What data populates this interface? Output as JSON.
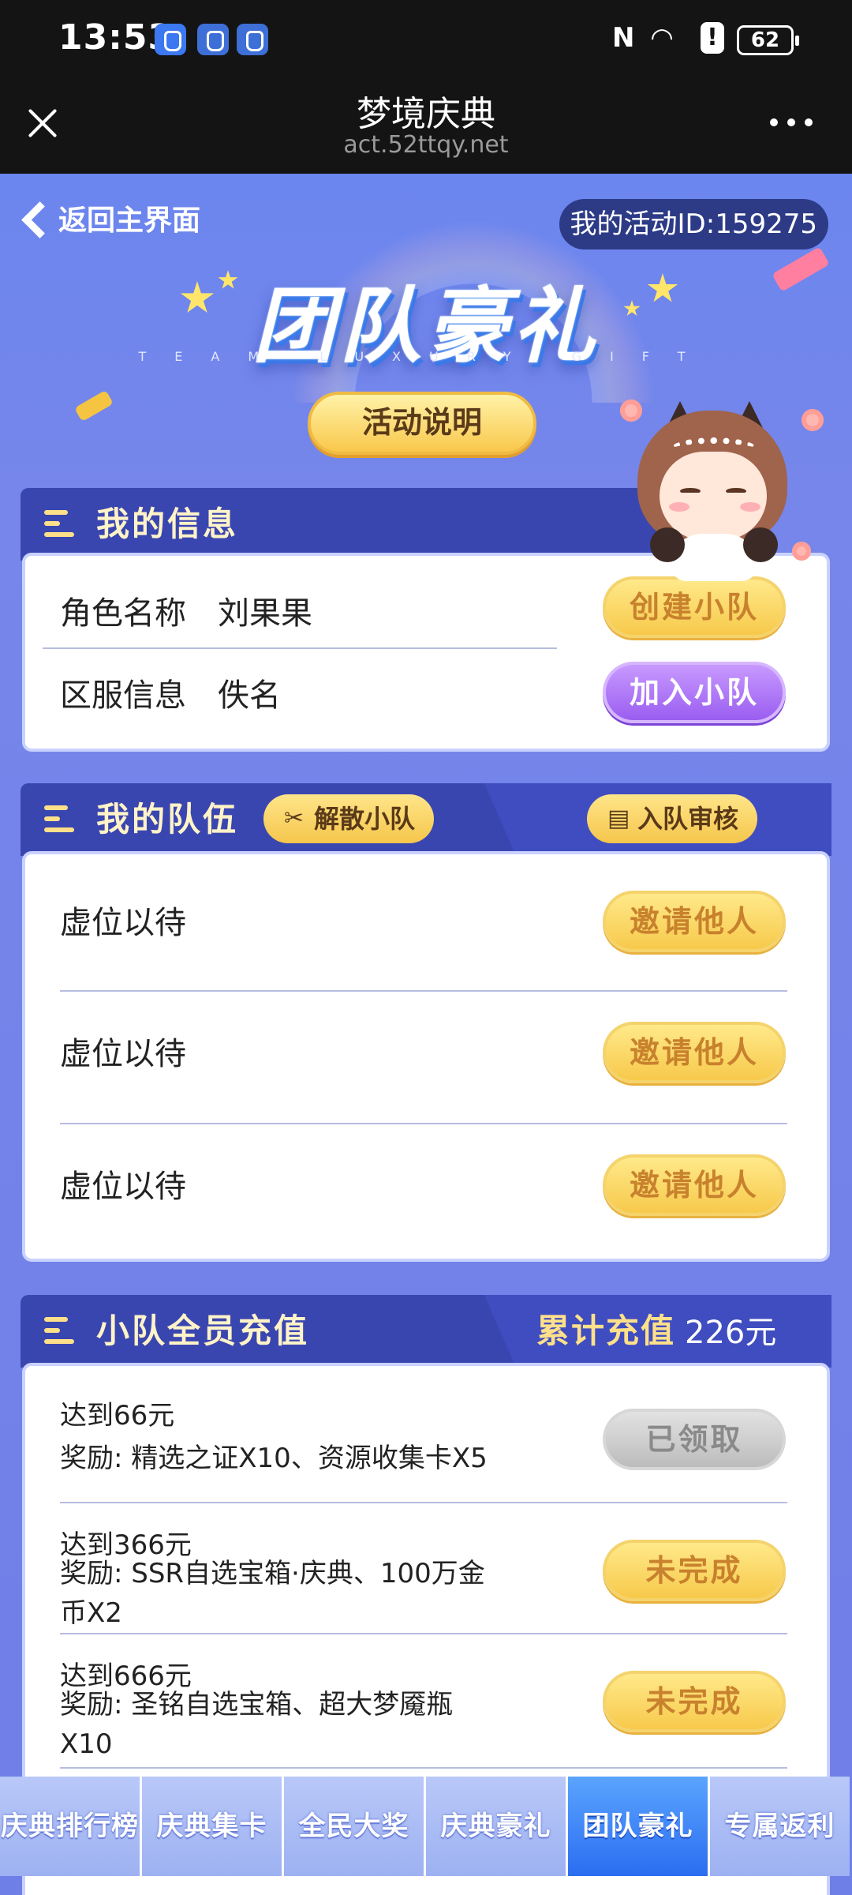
{
  "status_bar": {
    "time": "13:53",
    "battery": "62",
    "icons": [
      "shield-app-icon",
      "app-icon",
      "app-icon",
      "nfc-icon",
      "wifi-icon",
      "alert-icon",
      "battery-icon"
    ]
  },
  "browser": {
    "title": "梦境庆典",
    "url": "act.52ttqy.net"
  },
  "top": {
    "back_label": "返回主界面",
    "activity_id": "我的活动ID:159275",
    "hero_title": "团队豪礼",
    "hero_subtitle": "TEAM LUXURY GIFT",
    "info_button": "活动说明"
  },
  "my_info": {
    "title": "我的信息",
    "role_label": "角色名称",
    "role_value": "刘果果",
    "server_label": "区服信息",
    "server_value": "佚名",
    "create_button": "创建小队",
    "join_button": "加入小队"
  },
  "my_team": {
    "title": "我的队伍",
    "disband_button": "解散小队",
    "review_button": "入队审核",
    "slots": [
      {
        "label": "虚位以待",
        "button": "邀请他人"
      },
      {
        "label": "虚位以待",
        "button": "邀请他人"
      },
      {
        "label": "虚位以待",
        "button": "邀请他人"
      }
    ]
  },
  "recharge": {
    "title": "小队全员充值",
    "total_label": "累计充值",
    "total_value": "226元",
    "rewards": [
      {
        "target": "达到66元",
        "reward": "奖励: 精选之证X10、资源收集卡X5",
        "status": "已领取"
      },
      {
        "target": "达到366元",
        "reward": "奖励: SSR自选宝箱·庆典、100万金",
        "reward_cont": "币X2",
        "status": "未完成"
      },
      {
        "target": "达到666元",
        "reward": "奖励: 圣铭自选宝箱、超大梦魇瓶",
        "reward_cont": "X10",
        "status": "未完成"
      }
    ]
  },
  "tabs": [
    {
      "label": "庆典排行榜",
      "active": false
    },
    {
      "label": "庆典集卡",
      "active": false
    },
    {
      "label": "全民大奖",
      "active": false
    },
    {
      "label": "庆典豪礼",
      "active": false
    },
    {
      "label": "团队豪礼",
      "active": true
    },
    {
      "label": "专属返利",
      "active": false
    }
  ],
  "colors": {
    "background": "#6f84ee",
    "header_bar": "#3a46b0",
    "yellow_button": "#f7c94b",
    "purple_button": "#9a5ef0",
    "active_tab": "#2b6df0"
  }
}
